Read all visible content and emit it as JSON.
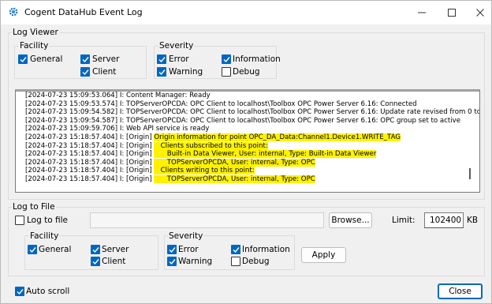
{
  "window": {
    "title": "Cogent DataHub Event Log",
    "controls": [
      "minimize-icon",
      "maximize-icon",
      "close-icon"
    ]
  },
  "log_viewer": {
    "label": "Log Viewer",
    "facility": {
      "label": "Facility",
      "general": {
        "label": "General",
        "checked": true
      },
      "server": {
        "label": "Server",
        "checked": true
      },
      "client": {
        "label": "Client",
        "checked": true
      }
    },
    "severity": {
      "label": "Severity",
      "error": {
        "label": "Error",
        "checked": true
      },
      "information": {
        "label": "Information",
        "checked": true
      },
      "warning": {
        "label": "Warning",
        "checked": true
      },
      "debug": {
        "label": "Debug",
        "checked": false
      }
    },
    "lines": [
      {
        "prefix": "[2024-07-23 15:09:53.064] I: ",
        "text": "Content Manager: Ready",
        "highlight": false
      },
      {
        "prefix": "[2024-07-23 15:09:53.574] I: ",
        "text": "TOPServerOPCDA: OPC Client to localhost\\Toolbox OPC Power Server 6.16: Connected",
        "highlight": false
      },
      {
        "prefix": "[2024-07-23 15:09:54.582] I: ",
        "text": "TOPServerOPCDA: OPC Client to localhost\\Toolbox OPC Power Server 6.16: Update rate revised from 0 to 10",
        "highlight": false
      },
      {
        "prefix": "[2024-07-23 15:09:54.587] I: ",
        "text": "TOPServerOPCDA: OPC Client to localhost\\Toolbox OPC Power Server 6.16: OPC group set to active",
        "highlight": false
      },
      {
        "prefix": "[2024-07-23 15:09:59.706] I: ",
        "text": "Web API service is ready",
        "highlight": false
      },
      {
        "prefix": "[2024-07-23 15:18:57.404] I: [Origin] ",
        "text": "Origin information for point OPC_DA_Data:Channel1.Device1.WRITE_TAG",
        "highlight": true
      },
      {
        "prefix": "[2024-07-23 15:18:57.404] I: [Origin] ",
        "text": "   Clients subscribed to this point:",
        "highlight": true
      },
      {
        "prefix": "[2024-07-23 15:18:57.404] I: [Origin] ",
        "text": "      Built-in Data Viewer, User: internal, Type: Built-in Data Viewer",
        "highlight": true
      },
      {
        "prefix": "[2024-07-23 15:18:57.404] I: [Origin] ",
        "text": "      TOPServerOPCDA, User: internal, Type: OPC",
        "highlight": true
      },
      {
        "prefix": "[2024-07-23 15:18:57.404] I: [Origin] ",
        "text": "   Clients writing to this point:",
        "highlight": true
      },
      {
        "prefix": "[2024-07-23 15:18:57.404] I: [Origin] ",
        "text": "      TOPServerOPCDA, User: internal, Type: OPC",
        "highlight": true
      }
    ]
  },
  "log_to_file": {
    "label": "Log to File",
    "log_to_file": {
      "label": "Log to file",
      "checked": false
    },
    "path_value": "",
    "browse_label": "Browse...",
    "limit_label": "Limit:",
    "limit_value": "102400",
    "limit_unit": "KB",
    "facility": {
      "label": "Facility",
      "general": {
        "label": "General",
        "checked": true
      },
      "server": {
        "label": "Server",
        "checked": true
      },
      "client": {
        "label": "Client",
        "checked": true
      }
    },
    "severity": {
      "label": "Severity",
      "error": {
        "label": "Error",
        "checked": true
      },
      "information": {
        "label": "Information",
        "checked": true
      },
      "warning": {
        "label": "Warning",
        "checked": true
      },
      "debug": {
        "label": "Debug",
        "checked": false
      }
    },
    "apply_label": "Apply"
  },
  "auto_scroll": {
    "label": "Auto scroll",
    "checked": true
  },
  "close_label": "Close",
  "colors": {
    "accent": "#0067c0",
    "highlight": "#fff200"
  }
}
